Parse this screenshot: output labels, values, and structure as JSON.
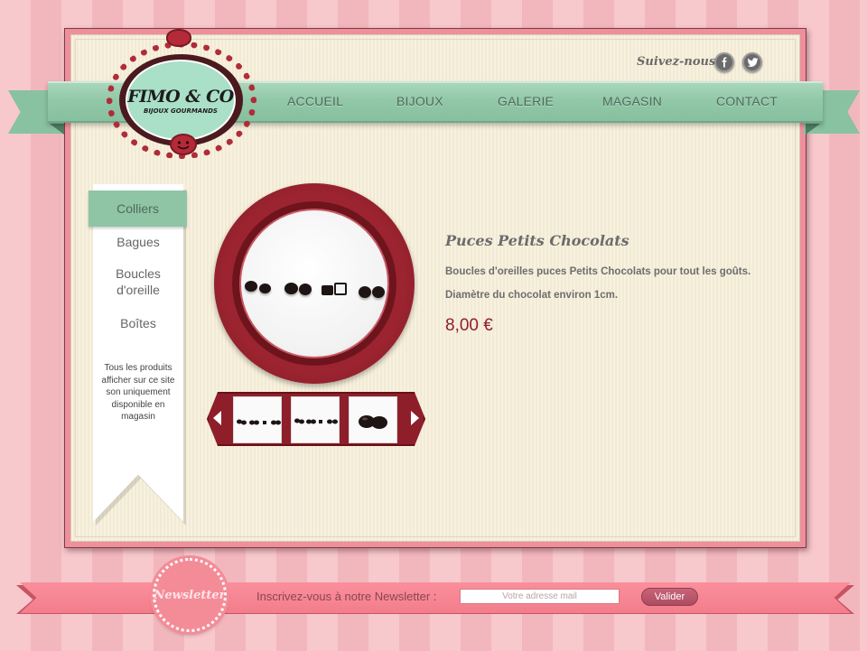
{
  "header": {
    "follow_label": "Suivez-nous",
    "social_icons": [
      "facebook-icon",
      "twitter-icon"
    ]
  },
  "logo": {
    "title": "FIMO & CO",
    "subtitle": "BIJOUX GOURMANDS"
  },
  "nav": {
    "items": [
      "ACCUEIL",
      "BIJOUX",
      "GALERIE",
      "MAGASIN",
      "CONTACT"
    ]
  },
  "sidebar": {
    "items": [
      {
        "label": "Colliers",
        "active": true
      },
      {
        "label": "Bagues",
        "active": false
      },
      {
        "label": "Boucles d'oreille",
        "active": false
      },
      {
        "label": "Boîtes",
        "active": false
      }
    ],
    "note": "Tous les produits afficher sur ce site son uniquement disponible en magasin"
  },
  "product": {
    "title": "Puces Petits Chocolats",
    "description_1": "Boucles d'oreilles puces Petits Chocolats pour tout les goûts.",
    "description_2": "Diamètre du chocolat environ 1cm.",
    "price": "8,00 €"
  },
  "newsletter": {
    "badge": "Newsletter",
    "label": "Inscrivez-vous à notre Newsletter :",
    "input_placeholder": "Votre adresse mail",
    "button_label": "Valider"
  },
  "colors": {
    "accent_mint": "#8fc5a5",
    "accent_red": "#8e1f2a",
    "pink": "#f48c98",
    "cream": "#f5efdc"
  }
}
